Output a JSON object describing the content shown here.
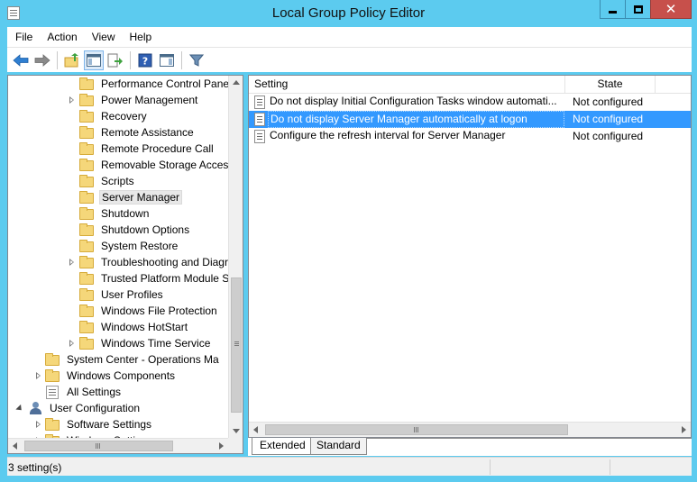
{
  "window": {
    "title": "Local Group Policy Editor"
  },
  "menu": [
    "File",
    "Action",
    "View",
    "Help"
  ],
  "toolbar": [
    "back-arrow-icon",
    "forward-arrow-icon",
    "up-folder-icon",
    "show-hide-tree-icon",
    "export-list-icon",
    "help-icon",
    "properties-pane-icon",
    "filter-icon"
  ],
  "tree": [
    {
      "label": "Performance Control Panel",
      "expander": "none",
      "icon": "folder",
      "selected": false
    },
    {
      "label": "Power Management",
      "expander": "closed",
      "icon": "folder",
      "selected": false
    },
    {
      "label": "Recovery",
      "expander": "none",
      "icon": "folder",
      "selected": false
    },
    {
      "label": "Remote Assistance",
      "expander": "none",
      "icon": "folder",
      "selected": false
    },
    {
      "label": "Remote Procedure Call",
      "expander": "none",
      "icon": "folder",
      "selected": false
    },
    {
      "label": "Removable Storage Access",
      "expander": "none",
      "icon": "folder",
      "selected": false
    },
    {
      "label": "Scripts",
      "expander": "none",
      "icon": "folder",
      "selected": false
    },
    {
      "label": "Server Manager",
      "expander": "none",
      "icon": "folder",
      "selected": true
    },
    {
      "label": "Shutdown",
      "expander": "none",
      "icon": "folder",
      "selected": false
    },
    {
      "label": "Shutdown Options",
      "expander": "none",
      "icon": "folder",
      "selected": false
    },
    {
      "label": "System Restore",
      "expander": "none",
      "icon": "folder",
      "selected": false
    },
    {
      "label": "Troubleshooting and Diagr",
      "expander": "closed",
      "icon": "folder",
      "selected": false
    },
    {
      "label": "Trusted Platform Module S",
      "expander": "none",
      "icon": "folder",
      "selected": false
    },
    {
      "label": "User Profiles",
      "expander": "none",
      "icon": "folder",
      "selected": false
    },
    {
      "label": "Windows File Protection",
      "expander": "none",
      "icon": "folder",
      "selected": false
    },
    {
      "label": "Windows HotStart",
      "expander": "none",
      "icon": "folder",
      "selected": false
    },
    {
      "label": "Windows Time Service",
      "expander": "closed",
      "icon": "folder",
      "selected": false
    },
    {
      "label": "System Center - Operations Ma",
      "expander": "none",
      "icon": "folder",
      "selected": false
    },
    {
      "label": "Windows Components",
      "expander": "closed",
      "icon": "folder",
      "selected": false
    },
    {
      "label": "All Settings",
      "expander": "none",
      "icon": "all-settings",
      "selected": false
    },
    {
      "label": "User Configuration",
      "expander": "open",
      "icon": "user",
      "selected": false
    },
    {
      "label": "Software Settings",
      "expander": "closed",
      "icon": "folder",
      "selected": false
    },
    {
      "label": "Windows Settings",
      "expander": "closed",
      "icon": "folder",
      "selected": false
    }
  ],
  "list": {
    "columns": {
      "setting": "Setting",
      "state": "State"
    },
    "rows": [
      {
        "setting": "Do not display Initial Configuration Tasks window automati...",
        "state": "Not configured",
        "selected": false
      },
      {
        "setting": "Do not display Server Manager automatically at logon",
        "state": "Not configured",
        "selected": true
      },
      {
        "setting": "Configure the refresh interval for Server Manager",
        "state": "Not configured",
        "selected": false
      }
    ]
  },
  "tabs": {
    "extended": "Extended",
    "standard": "Standard"
  },
  "status": {
    "text": "3 setting(s)"
  },
  "colors": {
    "titlebar": "#5ccbef",
    "selection": "#3399ff",
    "close_button": "#c7504b"
  }
}
